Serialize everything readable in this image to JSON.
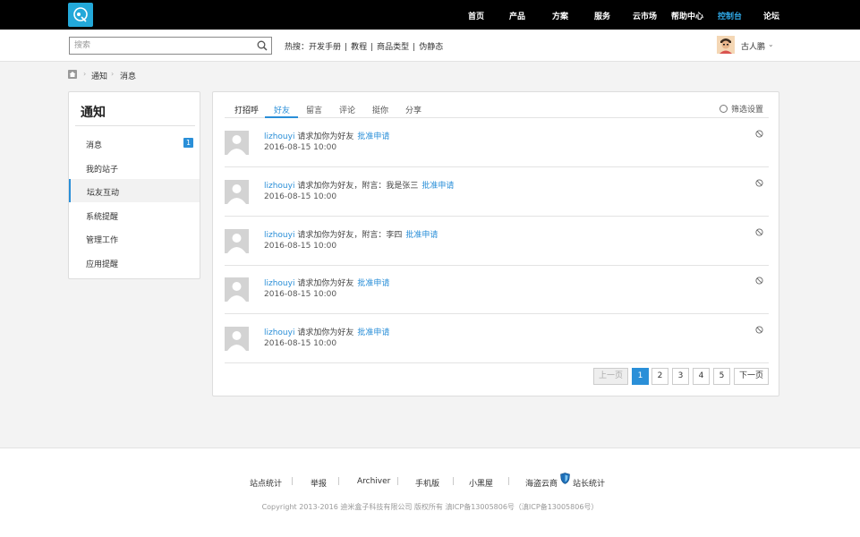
{
  "brand": {
    "accent": "#2a8fd8",
    "logo_bg": "#23a8d9"
  },
  "nav": {
    "items": [
      {
        "label": "首页"
      },
      {
        "label": "产品"
      },
      {
        "label": "方案"
      },
      {
        "label": "服务"
      },
      {
        "label": "云市场"
      },
      {
        "label": "帮助中心"
      },
      {
        "label": "控制台",
        "active": true
      },
      {
        "label": "论坛"
      }
    ]
  },
  "search": {
    "placeholder": "搜索",
    "icon": "search-icon"
  },
  "hot": {
    "prefix": "热搜：",
    "items": [
      "开发手册",
      "教程",
      "商品类型",
      "伪静态"
    ],
    "separator": "|"
  },
  "user": {
    "name": "古人鹏",
    "chevron": "⌄"
  },
  "breadcrumb": {
    "items": [
      "通知",
      "消息"
    ],
    "separator": "›"
  },
  "sidebar": {
    "title": "通知",
    "items": [
      {
        "label": "消息",
        "badge": "1"
      },
      {
        "label": "我的站子"
      },
      {
        "label": "坛友互动",
        "active": true
      },
      {
        "label": "系统提醒"
      },
      {
        "label": "管理工作"
      },
      {
        "label": "应用提醒"
      }
    ]
  },
  "tabs": {
    "items": [
      {
        "label": "打招呼"
      },
      {
        "label": "好友",
        "active": true
      },
      {
        "label": "留言"
      },
      {
        "label": "评论"
      },
      {
        "label": "挺你"
      },
      {
        "label": "分享"
      }
    ],
    "filter": "筛选设置"
  },
  "notices": [
    {
      "user": "lizhouyi",
      "text": " 请求加你为好友",
      "link": "批准申请",
      "time": "2016-08-15 10:00"
    },
    {
      "user": "lizhouyi",
      "text": " 请求加你为好友，附言：我是张三",
      "link": "批准申请",
      "time": "2016-08-15 10:00"
    },
    {
      "user": "lizhouyi",
      "text": " 请求加你为好友，附言：李四",
      "link": "批准申请",
      "time": "2016-08-15 10:00"
    },
    {
      "user": "lizhouyi",
      "text": " 请求加你为好友",
      "link": "批准申请",
      "time": "2016-08-15 10:00"
    },
    {
      "user": "lizhouyi",
      "text": " 请求加你为好友",
      "link": "批准申请",
      "time": "2016-08-15 10:00"
    }
  ],
  "pagination": {
    "prev": "上一页",
    "pages": [
      "1",
      "2",
      "3",
      "4",
      "5"
    ],
    "current": "1",
    "next": "下一页"
  },
  "footer": {
    "links": [
      "站点统计",
      "举报",
      "Archiver",
      "手机版",
      "小黑屋",
      "海盗云商",
      "站长统计"
    ],
    "separator": "|",
    "copyright": "Copyright 2013-2016 迪米盒子科技有限公司 版权所有 滇ICP备13005806号（滇ICP备13005806号）"
  }
}
